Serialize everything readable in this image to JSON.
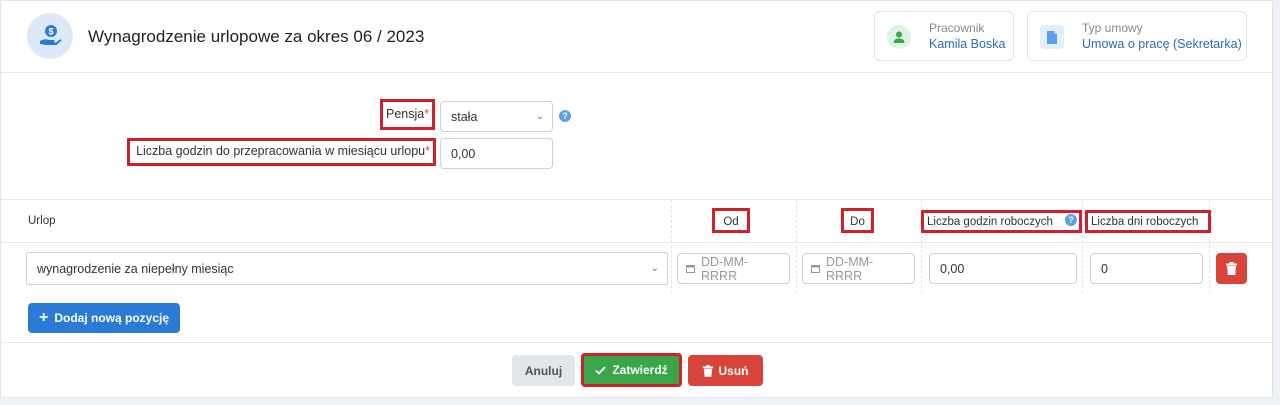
{
  "header": {
    "title": "Wynagrodzenie urlopowe za okres 06 / 2023",
    "employee": {
      "label": "Pracownik",
      "value": "Kamila Boska"
    },
    "contract": {
      "label": "Typ umowy",
      "value": "Umowa o pracę (Sekretarka)"
    }
  },
  "form": {
    "salary": {
      "label": "Pensja",
      "required": "*",
      "value": "stała",
      "help": "?"
    },
    "hours": {
      "label": "Liczba godzin do przepracowania w miesiącu urlopu",
      "required": "*",
      "value": "0,00"
    }
  },
  "table": {
    "headers": {
      "leave": "Urlop",
      "from": "Od",
      "to": "Do",
      "work_hours": "Liczba godzin roboczych",
      "work_days": "Liczba dni roboczych",
      "help": "?"
    },
    "row": {
      "leave_type": "wynagrodzenie za niepełny miesiąc",
      "from_placeholder": "DD-MM-RRRR",
      "to_placeholder": "DD-MM-RRRR",
      "hours": "0,00",
      "days": "0"
    },
    "add_label": "Dodaj nową pozycję"
  },
  "footer": {
    "cancel": "Anuluj",
    "confirm": "Zatwierdź",
    "delete": "Usuń"
  },
  "colors": {
    "primary": "#2b7bd6",
    "success": "#3aa64a",
    "danger": "#d9443a",
    "highlight": "#d0212b"
  }
}
